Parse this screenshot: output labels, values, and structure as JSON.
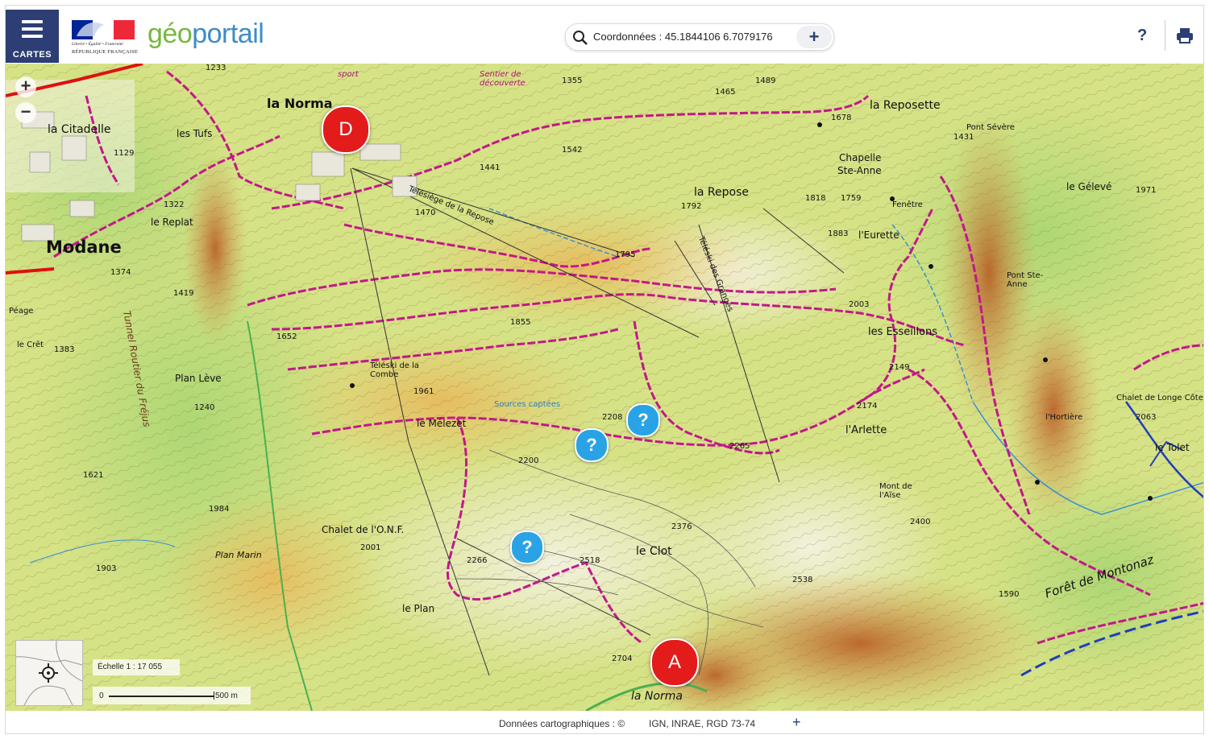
{
  "header": {
    "menu_label": "CARTES",
    "rf_motto": "Liberté • Égalité • Fraternité",
    "rf_republic": "RÉPUBLIQUE FRANÇAISE",
    "logo_geo": "géo",
    "logo_portail": "portail",
    "search_text": "Coordonnées : 45.1844106 6.7079176",
    "search_plus": "+",
    "help": "?"
  },
  "map": {
    "zoom_in": "+",
    "zoom_out": "−",
    "labels": {
      "la_norma": "la Norma",
      "modane": "Modane",
      "la_citadelle": "la Citadelle",
      "les_tufs": "les Tufs",
      "le_replat": "le Replat",
      "la_reposette": "la Reposette",
      "la_repose": "la Repose",
      "chapelle": "Chapelle",
      "ste_anne": "Ste-Anne",
      "leurette": "l'Eurette",
      "les_esseillons": "les Esseillons",
      "larlette": "l'Arlette",
      "le_melezet": "le Mélezet",
      "le_clot": "le Clot",
      "chalet_onf": "Chalet de l'O.N.F.",
      "plan_leve": "Plan Lève",
      "plan_marin": "Plan Marin",
      "le_plan": "le Plan",
      "foret_montonaz": "Forêt de Montonaz",
      "le_geleve": "le Gélevé",
      "pont_severe": "Pont Sévère",
      "pont_ste_anne": "Pont Ste-Anne",
      "le_tolet": "le Tolet",
      "lhortiere": "l'Hortière",
      "chalet_longe_cote": "Chalet de Longe Côte",
      "la_norma_bottom": "la Norma",
      "teleski_combe": "Téléski de la Combe",
      "telesiege_repose": "Télésiège de la Repose",
      "teleski_granges": "Téléski des Granges",
      "sources_captees": "Sources captées",
      "mont_de_laise": "Mont de l'Aïse",
      "peage": "Péage",
      "le_cret": "le Crêt",
      "sentier": "Sentier de découverte",
      "sport": "sport",
      "fenetre": "Fenêtre",
      "tunnel_routier": "Tunnel Routier du Fréjus"
    },
    "elevations": [
      "1233",
      "1355",
      "1465",
      "1489",
      "1542",
      "1441",
      "1470",
      "1795",
      "1792",
      "1818",
      "1759",
      "1883",
      "2003",
      "2149",
      "2174",
      "2265",
      "2208",
      "2200",
      "1855",
      "1961",
      "1652",
      "1383",
      "1419",
      "1322",
      "1374",
      "1129",
      "1240",
      "1621",
      "1984",
      "1903",
      "2001",
      "2266",
      "2518",
      "2376",
      "2538",
      "2704",
      "2400",
      "1590",
      "1971",
      "2063",
      "1431",
      "1678"
    ],
    "markers": {
      "d": "D",
      "a": "A"
    },
    "info_marker": "?",
    "scale_label": "Échelle 1 : 17 055",
    "scale_zero": "0",
    "scale_500": "500 m"
  },
  "footer": {
    "credit": "Données cartographiques : ©",
    "attribution": "IGN,  INRAE,  RGD 73-74",
    "more": "+"
  },
  "colors": {
    "brand_navy": "#2c3e73",
    "marker_red": "#e31b1b",
    "info_blue": "#29a3e6",
    "trail_magenta": "#c2188a"
  }
}
